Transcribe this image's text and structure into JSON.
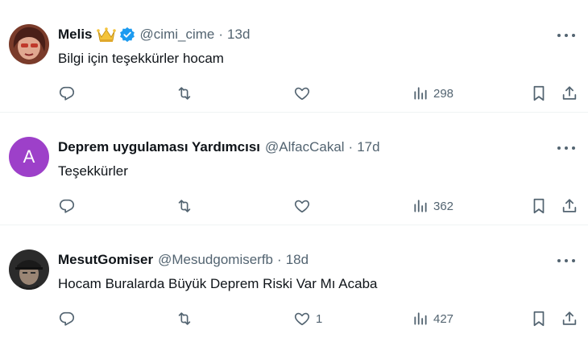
{
  "colors": {
    "text": "#0f1419",
    "muted": "#536471",
    "verified": "#1d9bf0",
    "crown": "#f4c33a",
    "avatar_letter_bg": "#9d40c9"
  },
  "tweets": [
    {
      "name": "Melis",
      "has_crown_emoji": true,
      "verified": true,
      "handle": "@cimi_cime",
      "dot": "·",
      "time": "13d",
      "text": "Bilgi için teşekkürler hocam",
      "avatar": "photo",
      "stats": {
        "replies": "",
        "retweets": "",
        "likes": "",
        "views": "298"
      }
    },
    {
      "name": "Deprem uygulaması Yardımcısı",
      "has_crown_emoji": false,
      "verified": false,
      "handle": "@AlfacCakal",
      "dot": "·",
      "time": "17d",
      "text": "Teşekkürler",
      "avatar": "letter",
      "avatar_letter": "A",
      "stats": {
        "replies": "",
        "retweets": "",
        "likes": "",
        "views": "362"
      }
    },
    {
      "name": "MesutGomiser",
      "has_crown_emoji": false,
      "verified": false,
      "handle": "@Mesudgomiserfb",
      "dot": "·",
      "time": "18d",
      "text": "Hocam Buralarda Büyük Deprem Riski Var Mı Acaba",
      "avatar": "photo",
      "stats": {
        "replies": "",
        "retweets": "",
        "likes": "1",
        "views": "427"
      }
    }
  ],
  "icons": [
    "reply-icon",
    "retweet-icon",
    "like-icon",
    "views-icon",
    "bookmark-icon",
    "share-icon",
    "more-icon",
    "verified-badge-icon",
    "crown-emoji-icon"
  ]
}
